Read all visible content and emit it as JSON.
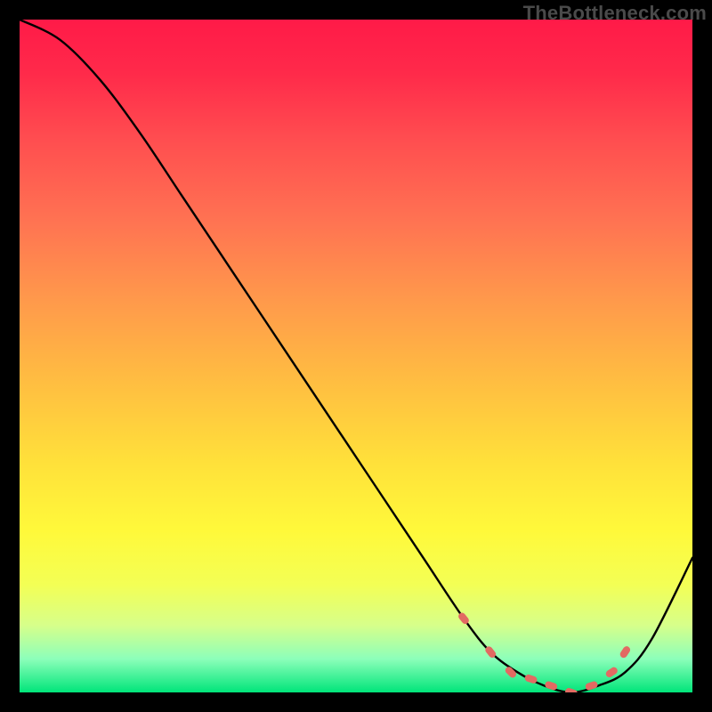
{
  "watermark": "TheBottleneck.com",
  "chart_data": {
    "type": "line",
    "title": "",
    "xlabel": "",
    "ylabel": "",
    "xlim": [
      0,
      100
    ],
    "ylim": [
      0,
      100
    ],
    "series": [
      {
        "name": "bottleneck-curve",
        "x": [
          0,
          6,
          12,
          18,
          24,
          30,
          36,
          42,
          48,
          54,
          60,
          66,
          70,
          74,
          78,
          82,
          86,
          90,
          94,
          100
        ],
        "y": [
          100,
          97,
          91,
          83,
          74,
          65,
          56,
          47,
          38,
          29,
          20,
          11,
          6,
          3,
          1,
          0,
          1,
          3,
          8,
          20
        ]
      }
    ],
    "markers": {
      "name": "optimal-zone-dots",
      "x": [
        66,
        70,
        73,
        76,
        79,
        82,
        85,
        88,
        90
      ],
      "y": [
        11,
        6,
        3,
        2,
        1,
        0,
        1,
        3,
        6
      ]
    }
  }
}
